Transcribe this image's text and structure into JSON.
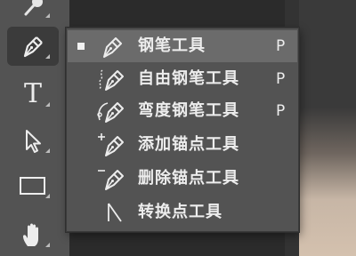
{
  "toolbar": {
    "tools": [
      {
        "icon": "eyedropper-icon",
        "active": false
      },
      {
        "icon": "pen-tool-icon",
        "active": true
      },
      {
        "icon": "type-tool-icon",
        "label": "T",
        "active": false
      },
      {
        "icon": "path-selection-icon",
        "active": false
      },
      {
        "icon": "rectangle-tool-icon",
        "active": false
      },
      {
        "icon": "hand-tool-icon",
        "active": false
      }
    ]
  },
  "flyout": {
    "items": [
      {
        "label": "钢笔工具",
        "shortcut": "P",
        "icon": "pen-icon",
        "selected": true
      },
      {
        "label": "自由钢笔工具",
        "shortcut": "P",
        "icon": "freeform-pen-icon",
        "selected": false
      },
      {
        "label": "弯度钢笔工具",
        "shortcut": "P",
        "icon": "curvature-pen-icon",
        "selected": false
      },
      {
        "label": "添加锚点工具",
        "shortcut": "",
        "icon": "add-anchor-point-icon",
        "selected": false
      },
      {
        "label": "删除锚点工具",
        "shortcut": "",
        "icon": "delete-anchor-point-icon",
        "selected": false
      },
      {
        "label": "转换点工具",
        "shortcut": "",
        "icon": "convert-point-icon",
        "selected": false
      }
    ]
  }
}
